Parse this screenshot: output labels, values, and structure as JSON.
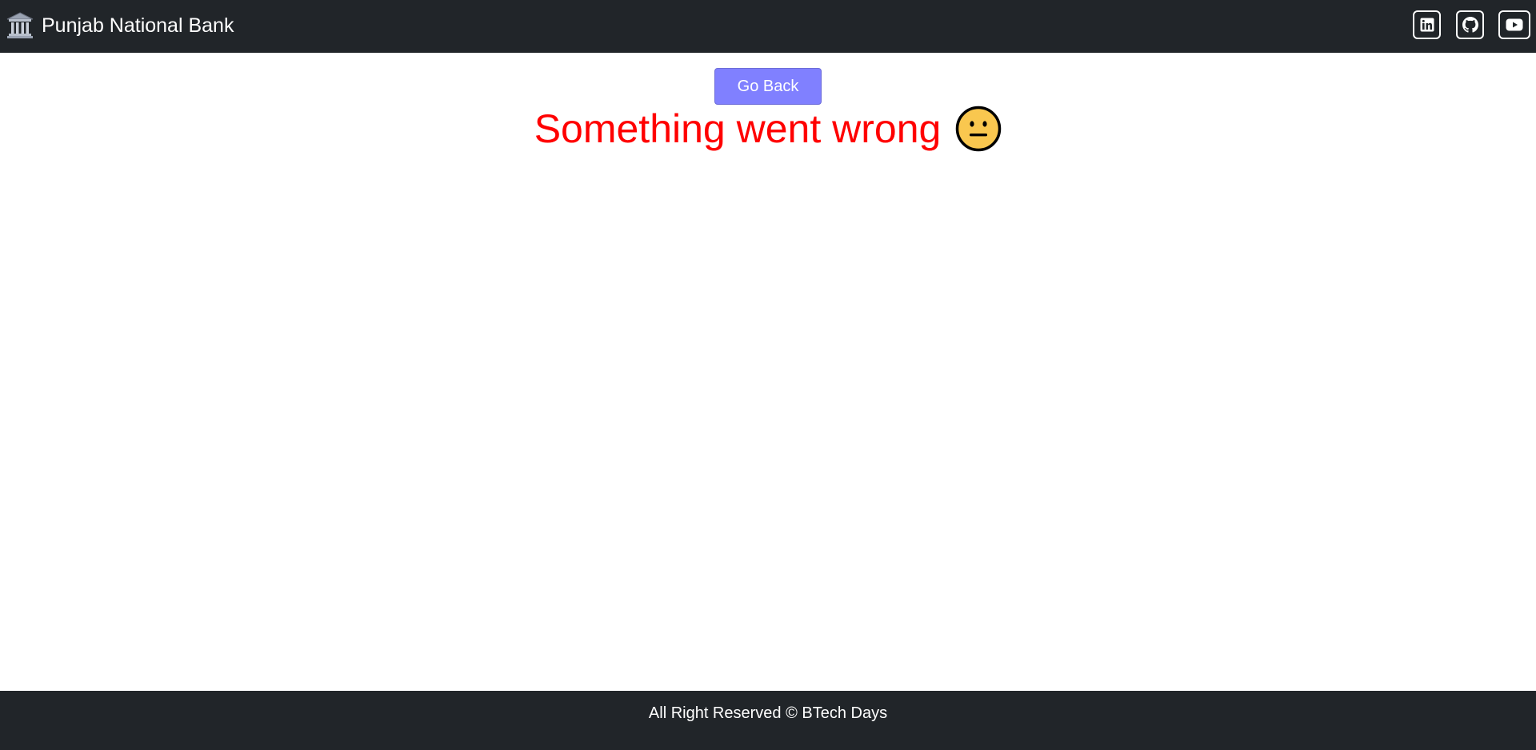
{
  "navbar": {
    "brand_icon": "bank-building-icon",
    "brand_name": "Punjab National Bank",
    "social_links": [
      {
        "name": "LinkedIn",
        "icon": "linkedin-icon"
      },
      {
        "name": "GitHub",
        "icon": "github-icon"
      },
      {
        "name": "YouTube",
        "icon": "youtube-icon"
      }
    ]
  },
  "main": {
    "go_back_label": "Go Back",
    "error_message": "Something went wrong",
    "error_emoji": "neutral-face-icon"
  },
  "footer": {
    "text": "All Right Reserved © BTech Days"
  },
  "colors": {
    "navbar_bg": "#212529",
    "button_bg": "#8080ff",
    "error_text": "#ff0000",
    "emoji_fill": "#f9c74f"
  }
}
